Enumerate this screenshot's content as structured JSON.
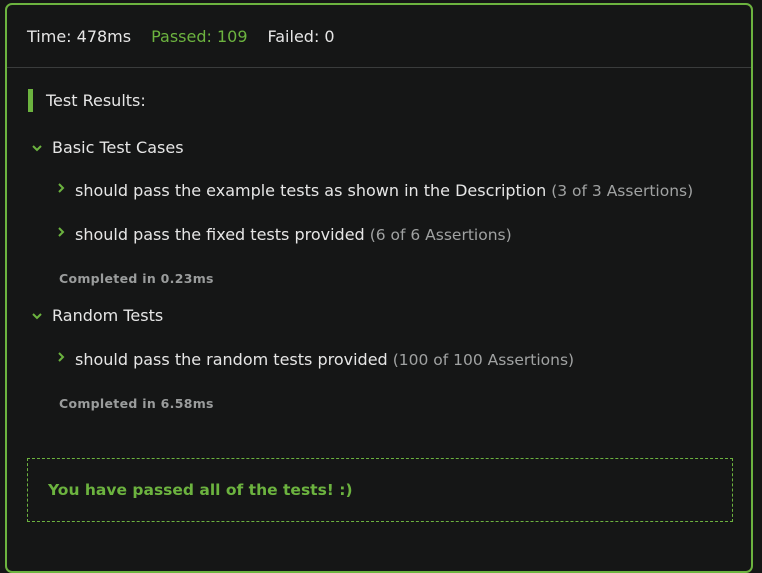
{
  "summary": {
    "time": "Time: 478ms",
    "passed": "Passed: 109",
    "failed": "Failed: 0"
  },
  "results": {
    "title": "Test Results:",
    "groups": [
      {
        "name": "Basic Test Cases",
        "tests": [
          {
            "label": "should pass the example tests as shown in the Description",
            "assertions": "(3 of 3 Assertions)"
          },
          {
            "label": "should pass the fixed tests provided",
            "assertions": "(6 of 6 Assertions)"
          }
        ],
        "completed": "Completed in 0.23ms"
      },
      {
        "name": "Random Tests",
        "tests": [
          {
            "label": "should pass the random tests provided",
            "assertions": "(100 of 100 Assertions)"
          }
        ],
        "completed": "Completed in 6.58ms"
      }
    ],
    "pass_message": "You have passed all of the tests! :)"
  },
  "colors": {
    "accent": "#6cb33f",
    "background": "#151616",
    "text": "#e6e6e6",
    "muted": "#a0a2a2"
  },
  "icons": {
    "group_toggle": "chevron-down-icon",
    "test_toggle": "chevron-right-icon",
    "title_marker": "green-bar"
  }
}
